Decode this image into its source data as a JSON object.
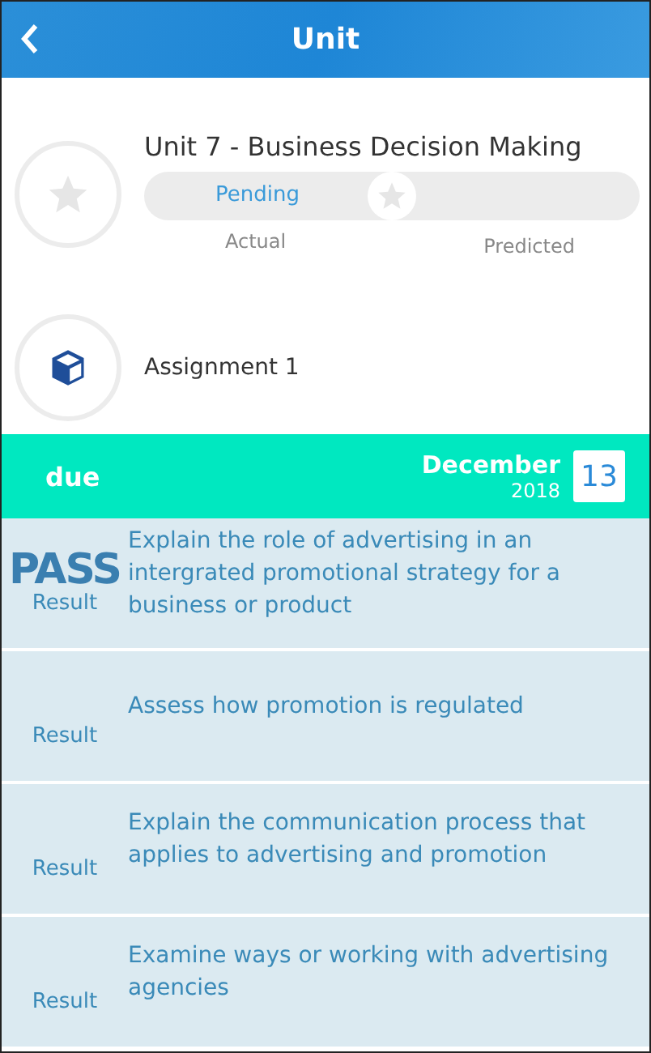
{
  "header": {
    "title": "Unit"
  },
  "unit": {
    "title": "Unit 7 - Business Decision Making",
    "status": "Pending",
    "level": 0.5,
    "actual_label": "Actual",
    "predicted_label": "Predicted"
  },
  "assignment": {
    "title": "Assignment 1"
  },
  "due": {
    "label": "due",
    "month": "December",
    "year": "2018",
    "day": "13"
  },
  "criteria": [
    {
      "grade": "PASS",
      "result_label": "Result",
      "text": "Explain the role of advertising in an intergrated promotional strategy for a business or product"
    },
    {
      "result_label": "Result",
      "text": "Assess how promotion is regulated"
    },
    {
      "result_label": "Result",
      "text": "Explain the communication process that applies to advertising and promotion"
    },
    {
      "result_label": "Result",
      "text": "Examine ways or working with advertising agencies"
    }
  ]
}
